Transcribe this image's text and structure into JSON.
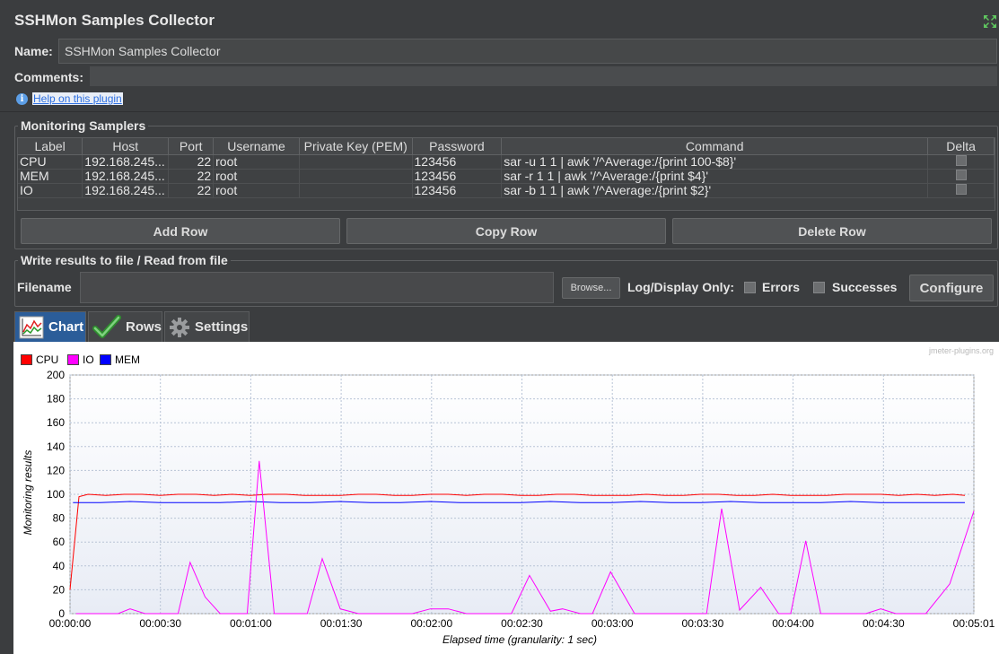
{
  "title": "SSHMon Samples Collector",
  "name_label": "Name:",
  "name_value": "SSHMon Samples Collector",
  "comments_label": "Comments:",
  "help_link": "Help on this plugin",
  "monitoring": {
    "legend": "Monitoring Samplers",
    "columns": [
      "Label",
      "Host",
      "Port",
      "Username",
      "Private Key (PEM)",
      "Password",
      "Command",
      "Delta"
    ],
    "rows": [
      {
        "label": "CPU",
        "host": "192.168.245...",
        "port": "22",
        "username": "root",
        "key": "",
        "password": "123456",
        "command": "sar -u 1 1 | awk '/^Average:/{print 100-$8}'"
      },
      {
        "label": "MEM",
        "host": "192.168.245...",
        "port": "22",
        "username": "root",
        "key": "",
        "password": "123456",
        "command": "sar -r 1 1 | awk '/^Average:/{print $4}'"
      },
      {
        "label": "IO",
        "host": "192.168.245...",
        "port": "22",
        "username": "root",
        "key": "",
        "password": "123456",
        "command": "sar -b 1 1 | awk '/^Average:/{print $2}'"
      }
    ],
    "add_row": "Add Row",
    "copy_row": "Copy Row",
    "delete_row": "Delete Row"
  },
  "file": {
    "legend": "Write results to file / Read from file",
    "filename_label": "Filename",
    "filename_value": "",
    "browse": "Browse...",
    "log_label": "Log/Display Only:",
    "errors": "Errors",
    "successes": "Successes",
    "configure": "Configure"
  },
  "tabs": [
    {
      "label": "Chart",
      "icon": "chart-icon",
      "active": true
    },
    {
      "label": "Rows",
      "icon": "checkmark-icon",
      "active": false
    },
    {
      "label": "Settings",
      "icon": "gear-icon",
      "active": false
    }
  ],
  "colors": {
    "cpu": "#ff0000",
    "io": "#ff00ff",
    "mem": "#0000ff",
    "tab_active": "#2b5d99"
  },
  "chart_data": {
    "type": "line",
    "watermark": "jmeter-plugins.org",
    "ylabel": "Monitoring results",
    "xlabel": "Elapsed time (granularity: 1 sec)",
    "ylim": [
      0,
      200
    ],
    "yticks": [
      "0",
      "20",
      "40",
      "60",
      "80",
      "100",
      "120",
      "140",
      "160",
      "180",
      "200"
    ],
    "xlim_seconds": [
      0,
      301
    ],
    "xticks": [
      "00:00:00",
      "00:00:30",
      "00:01:00",
      "00:01:30",
      "00:02:00",
      "00:02:30",
      "00:03:00",
      "00:03:30",
      "00:04:00",
      "00:04:30",
      "00:05:01"
    ],
    "grid": true,
    "legend_position": "top-left",
    "series": [
      {
        "name": "CPU",
        "color": "#ff0000",
        "x": [
          0,
          3,
          6,
          12,
          18,
          24,
          30,
          36,
          42,
          48,
          54,
          60,
          66,
          72,
          78,
          84,
          90,
          96,
          102,
          108,
          114,
          120,
          126,
          132,
          138,
          144,
          150,
          156,
          162,
          168,
          174,
          180,
          186,
          192,
          198,
          204,
          210,
          216,
          222,
          228,
          234,
          240,
          246,
          252,
          258,
          264,
          270,
          276,
          282,
          288,
          294,
          298
        ],
        "y": [
          20,
          98,
          100,
          99,
          100,
          100,
          99,
          100,
          100,
          99,
          100,
          99,
          100,
          100,
          99,
          99,
          99,
          100,
          100,
          99,
          99,
          100,
          100,
          99,
          100,
          100,
          99,
          99,
          100,
          100,
          99,
          99,
          99,
          100,
          99,
          99,
          100,
          100,
          99,
          99,
          100,
          99,
          99,
          99,
          100,
          100,
          100,
          99,
          100,
          99,
          100,
          99
        ]
      },
      {
        "name": "MEM",
        "color": "#0000ff",
        "x": [
          1,
          10,
          20,
          30,
          40,
          50,
          60,
          70,
          80,
          90,
          100,
          110,
          120,
          130,
          140,
          150,
          160,
          170,
          180,
          190,
          200,
          210,
          220,
          230,
          240,
          250,
          260,
          270,
          280,
          290,
          298
        ],
        "y": [
          93,
          93,
          94,
          93,
          93,
          93,
          94,
          93,
          93,
          94,
          93,
          93,
          94,
          93,
          93,
          93,
          94,
          93,
          93,
          94,
          93,
          93,
          94,
          93,
          93,
          93,
          94,
          93,
          93,
          93,
          93
        ]
      },
      {
        "name": "IO",
        "color": "#ff00ff",
        "x": [
          2,
          8,
          12,
          16,
          20,
          25,
          30,
          36,
          40,
          45,
          50,
          55,
          59,
          63,
          68,
          73,
          79,
          84,
          90,
          96,
          102,
          108,
          114,
          120,
          126,
          132,
          137,
          141,
          147,
          153,
          160,
          164,
          170,
          174,
          180,
          188,
          196,
          202,
          207,
          212,
          217,
          223,
          230,
          236,
          240,
          245,
          250,
          256,
          265,
          270,
          275,
          285,
          293,
          301
        ],
        "y": [
          0,
          0,
          0,
          0,
          4,
          0,
          0,
          0,
          43,
          14,
          0,
          0,
          0,
          128,
          0,
          0,
          0,
          46,
          4,
          0,
          0,
          0,
          0,
          4,
          4,
          0,
          0,
          0,
          0,
          32,
          2,
          4,
          0,
          0,
          35,
          0,
          0,
          0,
          0,
          0,
          88,
          3,
          22,
          0,
          0,
          61,
          0,
          0,
          0,
          4,
          0,
          0,
          25,
          86
        ]
      }
    ]
  }
}
